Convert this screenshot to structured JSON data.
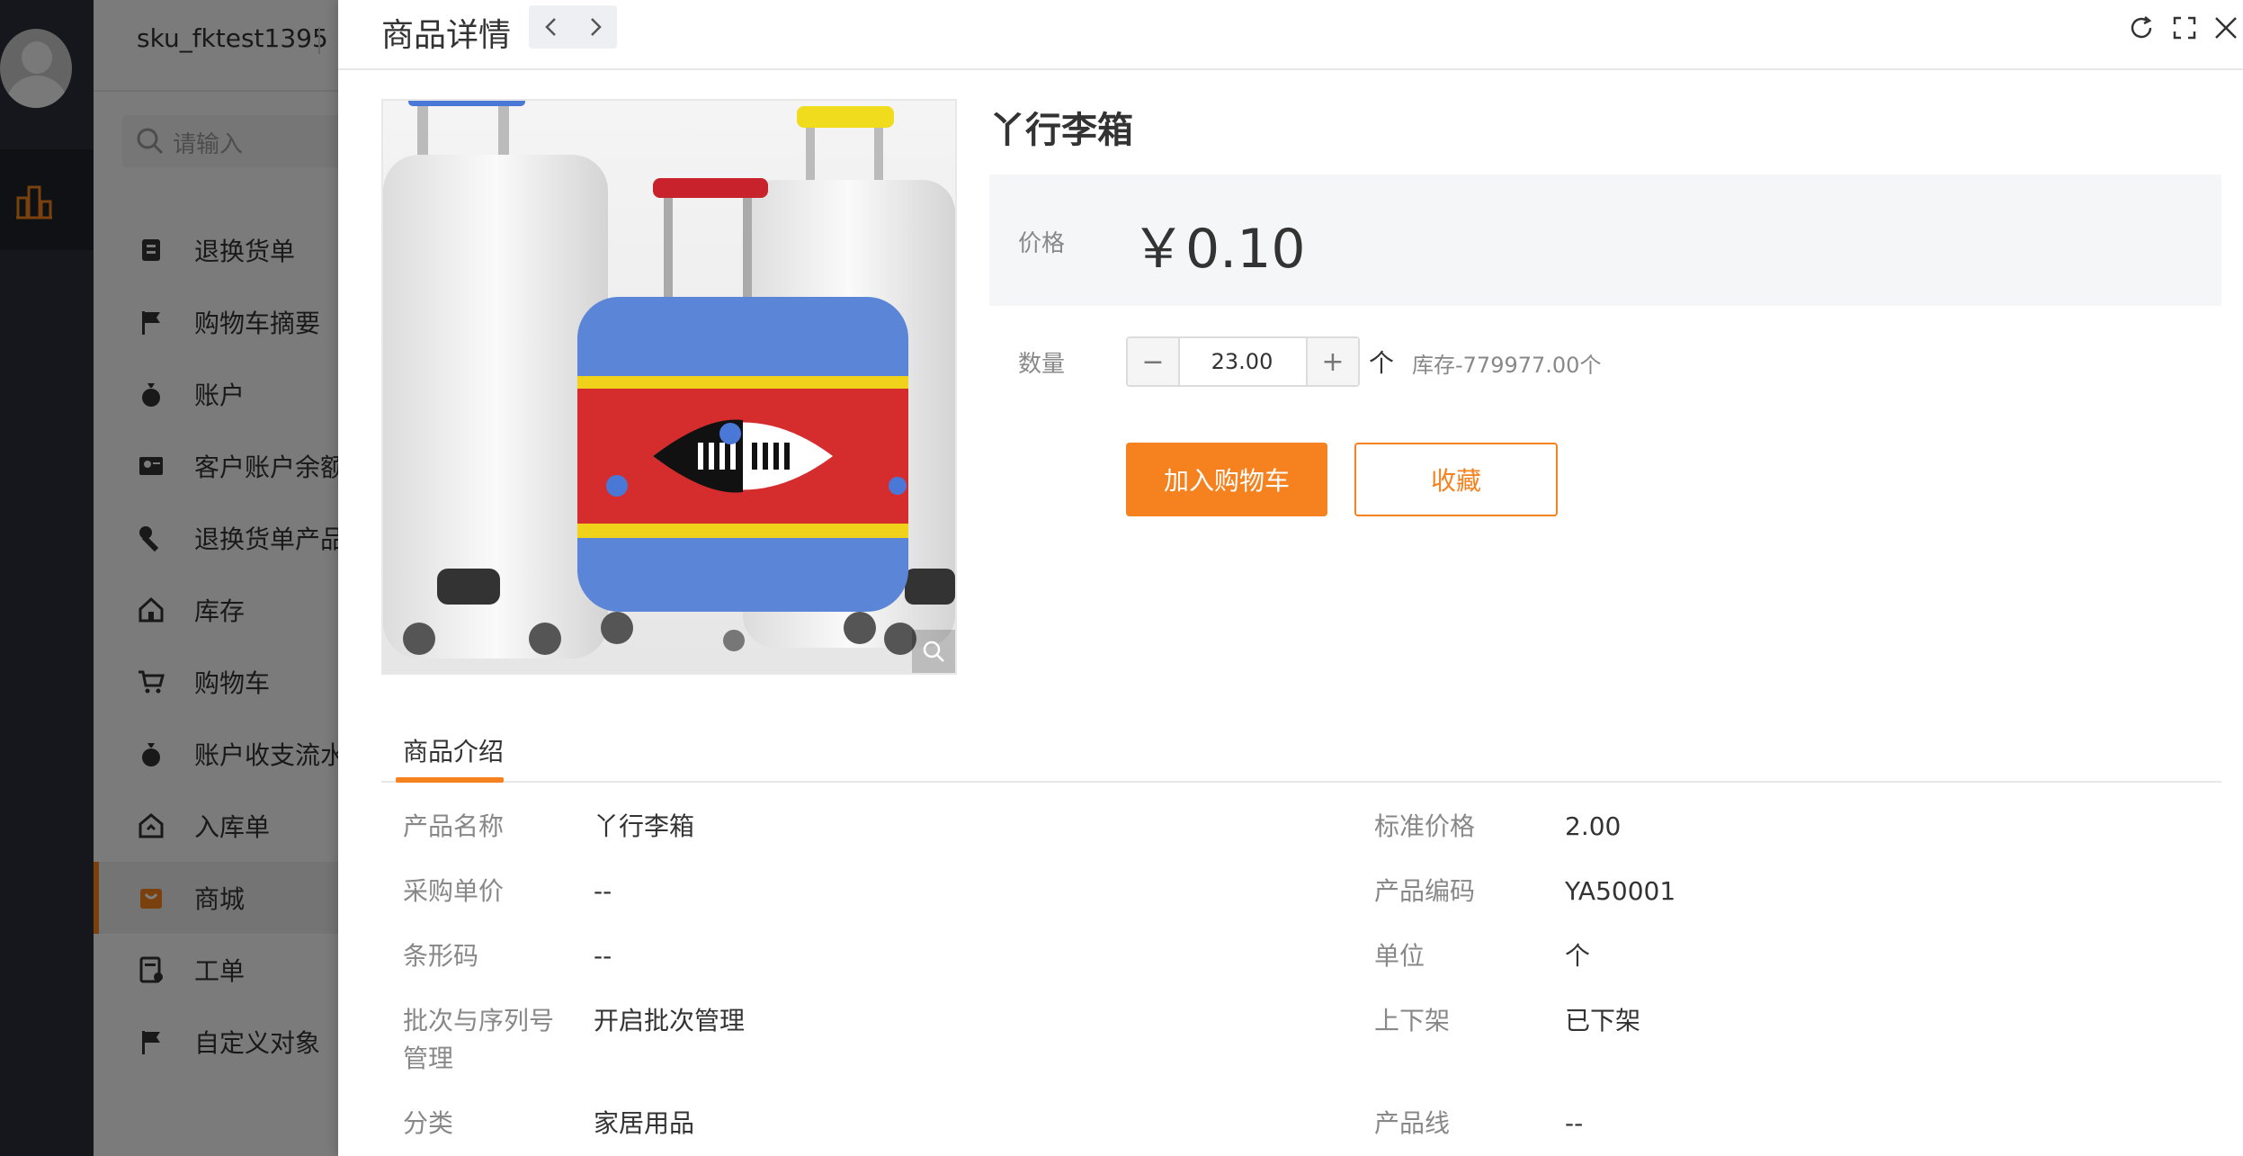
{
  "user": {
    "name": "sku_fktest1395"
  },
  "search": {
    "placeholder": "请输入"
  },
  "menu": [
    {
      "label": "退换货单",
      "icon": "return-order-icon"
    },
    {
      "label": "购物车摘要",
      "icon": "flag-icon"
    },
    {
      "label": "账户",
      "icon": "money-bag-icon"
    },
    {
      "label": "客户账户余额",
      "icon": "account-card-icon"
    },
    {
      "label": "退换货单产品",
      "icon": "wrench-icon"
    },
    {
      "label": "库存",
      "icon": "home-icon"
    },
    {
      "label": "购物车",
      "icon": "cart-icon"
    },
    {
      "label": "账户收支流水",
      "icon": "money-bag-icon"
    },
    {
      "label": "入库单",
      "icon": "inbound-icon"
    },
    {
      "label": "商城",
      "icon": "shopping-bag-icon",
      "active": true
    },
    {
      "label": "工单",
      "icon": "ticket-icon"
    },
    {
      "label": "自定义对象",
      "icon": "flag-icon"
    }
  ],
  "drawer": {
    "title": "商品详情",
    "product": {
      "name": "丫行李箱",
      "price_label": "价格",
      "price": "￥0.10",
      "qty_label": "数量",
      "qty_value": "23.00",
      "minus": "−",
      "plus": "+",
      "unit": "个",
      "stock": "库存-779977.00个"
    },
    "buttons": {
      "add_to_cart": "加入购物车",
      "favorite": "收藏"
    },
    "tab": "商品介绍",
    "attributes_left": [
      {
        "key": "产品名称",
        "value": "丫行李箱"
      },
      {
        "key": "采购单价",
        "value": "--"
      },
      {
        "key": "条形码",
        "value": "--"
      },
      {
        "key": "批次与序列号管理",
        "value": "开启批次管理"
      },
      {
        "key": "分类",
        "value": "家居用品"
      }
    ],
    "attributes_right": [
      {
        "key": "标准价格",
        "value": "2.00"
      },
      {
        "key": "产品编码",
        "value": "YA50001"
      },
      {
        "key": "单位",
        "value": "个"
      },
      {
        "key": "上下架",
        "value": "已下架"
      },
      {
        "key": "产品线",
        "value": "--"
      }
    ]
  },
  "colors": {
    "accent": "#f5821f",
    "rail": "#2b2f38"
  }
}
